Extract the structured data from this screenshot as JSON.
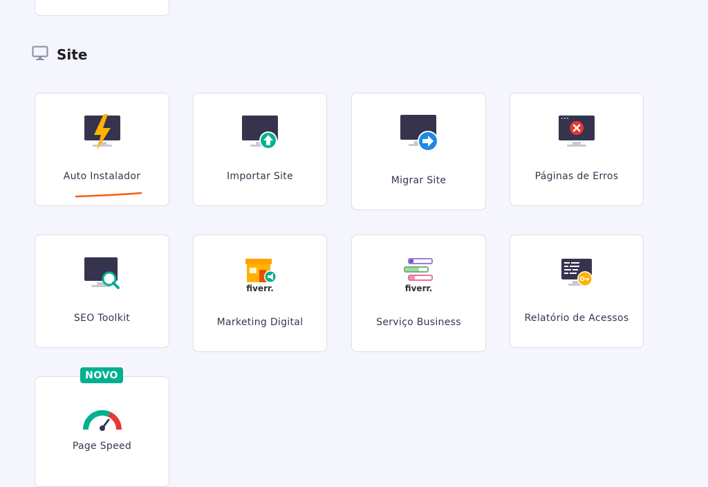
{
  "section": {
    "title": "Site",
    "icon": "monitor-icon"
  },
  "cards": [
    {
      "label": "Auto Instalador",
      "icon": "auto-installer-icon"
    },
    {
      "label": "Importar Site",
      "icon": "import-site-icon"
    },
    {
      "label": "Migrar Site",
      "icon": "migrate-site-icon"
    },
    {
      "label": "Páginas de Erros",
      "icon": "error-pages-icon"
    },
    {
      "label": "SEO Toolkit",
      "icon": "seo-toolkit-icon"
    },
    {
      "label": "Marketing Digital",
      "icon": "fiverr-marketing-icon",
      "logo_text": "fiverr."
    },
    {
      "label": "Serviço Business",
      "icon": "fiverr-business-icon",
      "logo_text": "fiverr."
    },
    {
      "label": "Relatório de Acessos",
      "icon": "access-report-icon"
    },
    {
      "label": "Page Speed",
      "icon": "page-speed-icon",
      "badge": "NOVO"
    }
  ],
  "colors": {
    "background": "#f4f5fd",
    "monitor": "#36344d",
    "green": "#00b090",
    "blue": "#1e88e5",
    "red": "#e53935",
    "orange": "#fc5b0b"
  }
}
